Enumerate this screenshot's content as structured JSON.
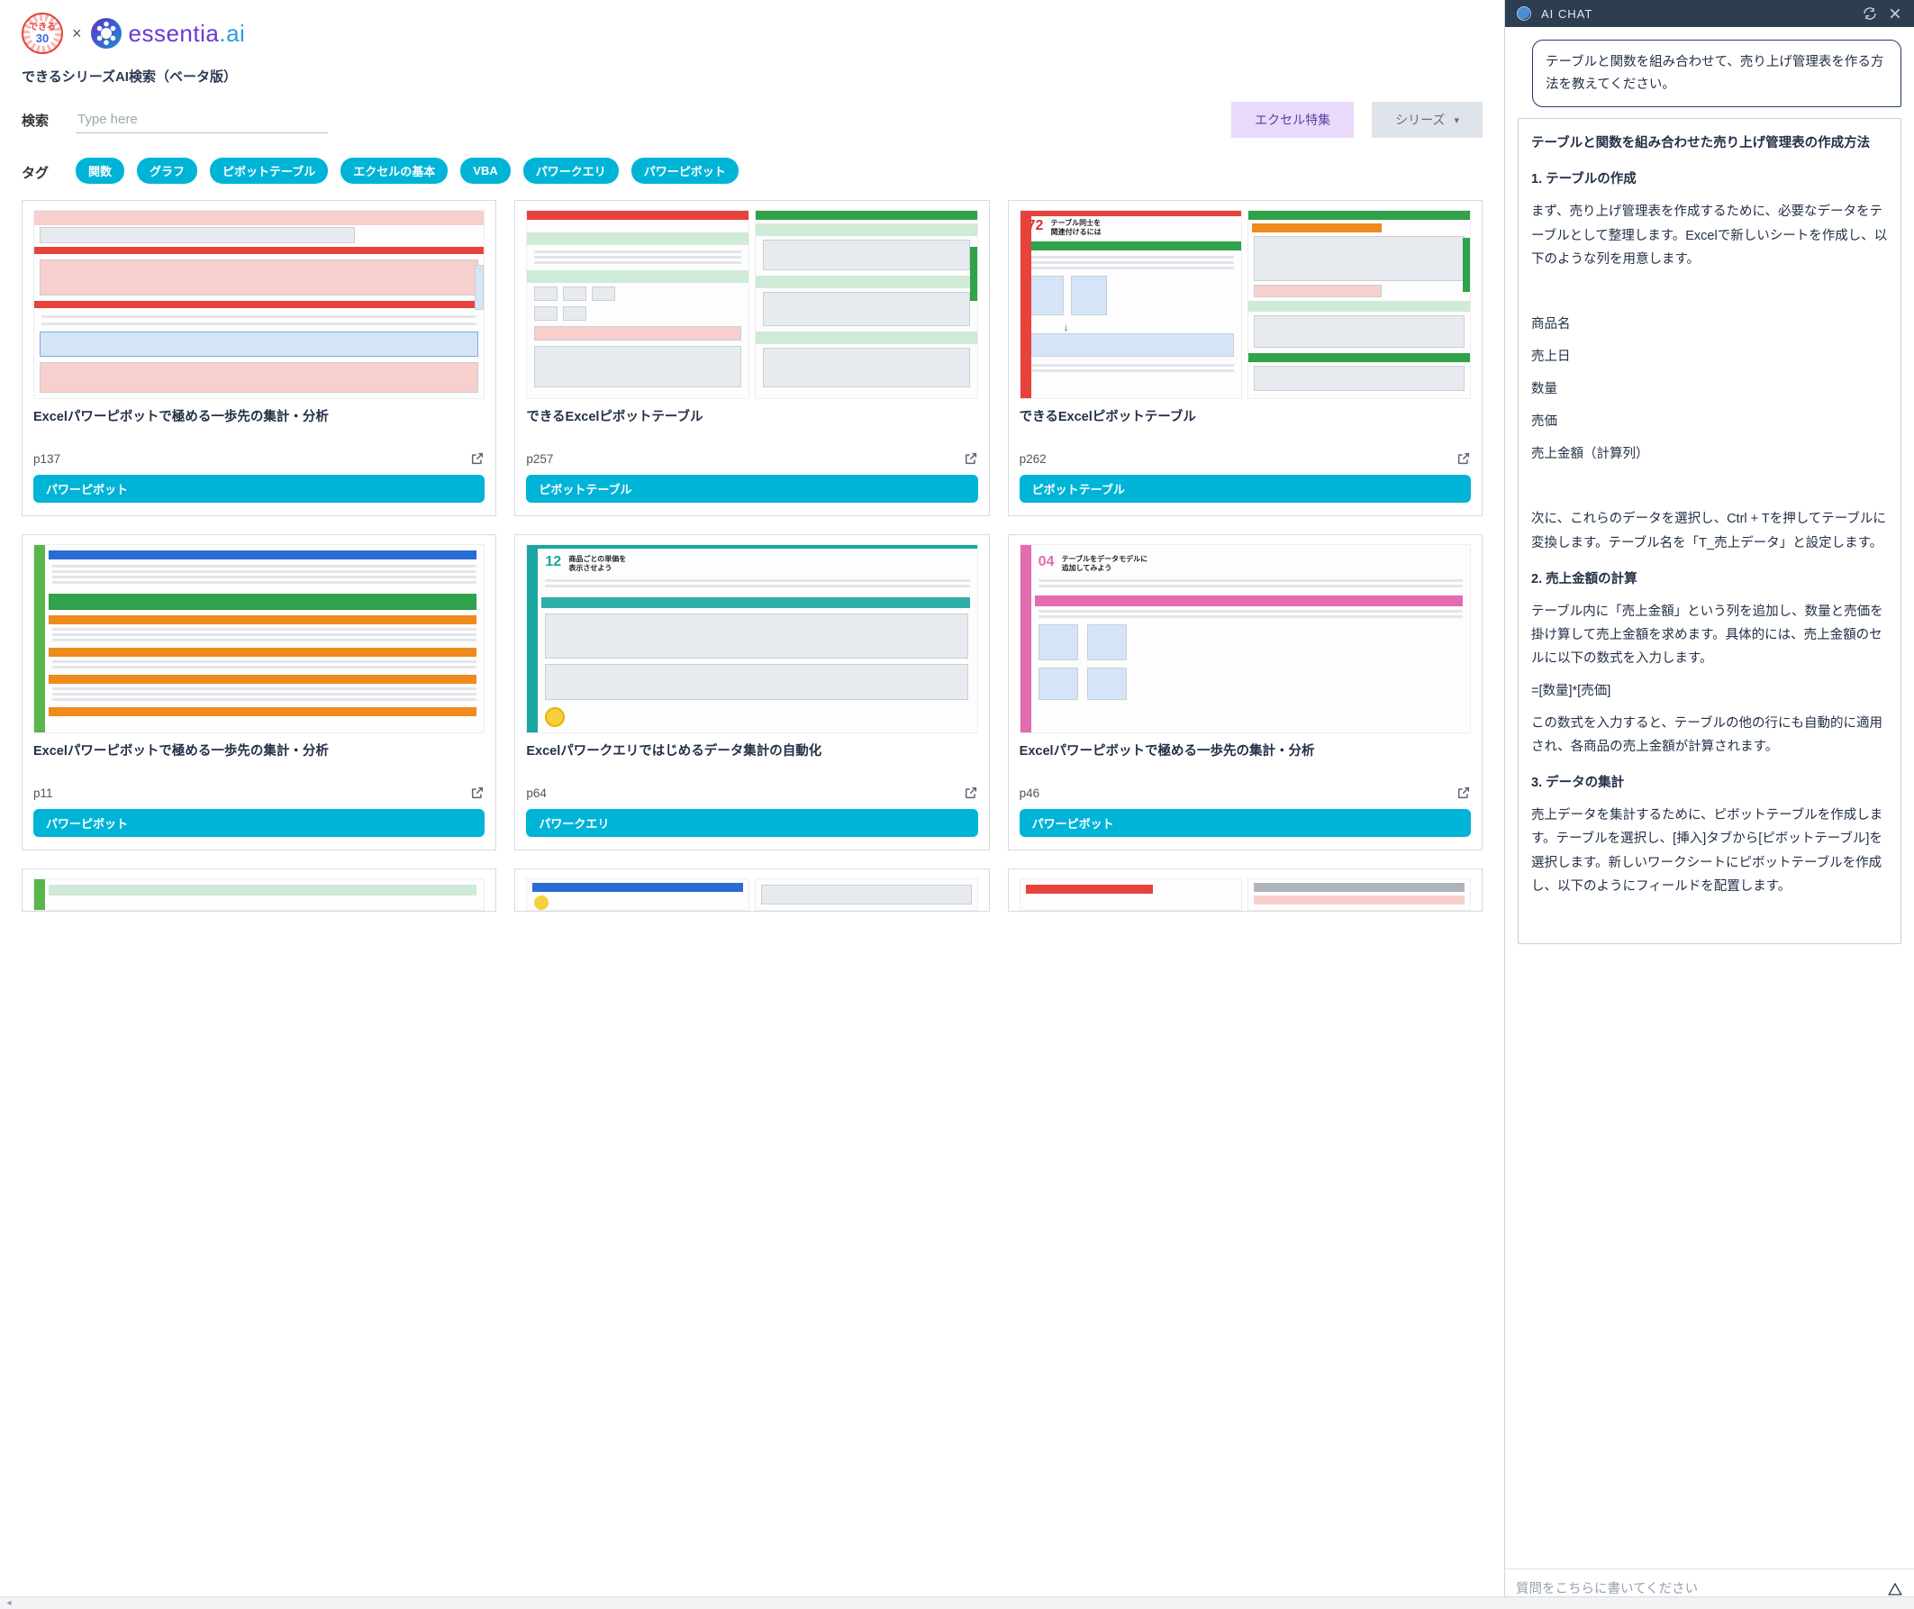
{
  "header": {
    "brand_x": "×",
    "brand_text_a": "essentia",
    "brand_text_b": ".ai",
    "badge_top": "できる",
    "badge_num": "30",
    "site_title": "できるシリーズAI検索（ベータ版）"
  },
  "search": {
    "label": "検索",
    "placeholder": "Type here",
    "btn_topic": "エクセル特集",
    "btn_series": "シリーズ"
  },
  "tags": {
    "label": "タグ",
    "items": [
      "関数",
      "グラフ",
      "ピボットテーブル",
      "エクセルの基本",
      "VBA",
      "パワークエリ",
      "パワーピボット"
    ]
  },
  "results": [
    {
      "title": "Excelパワーピボットで極める一歩先の集計・分析",
      "page": "p137",
      "tag": "パワーピボット"
    },
    {
      "title": "できるExcelピボットテーブル",
      "page": "p257",
      "tag": "ピボットテーブル"
    },
    {
      "title": "できるExcelピボットテーブル",
      "page": "p262",
      "tag": "ピボットテーブル"
    },
    {
      "title": "Excelパワーピボットで極める一歩先の集計・分析",
      "page": "p11",
      "tag": "パワーピボット"
    },
    {
      "title": "Excelパワークエリではじめるデータ集計の自動化",
      "page": "p64",
      "tag": "パワークエリ"
    },
    {
      "title": "Excelパワーピボットで極める一歩先の集計・分析",
      "page": "p46",
      "tag": "パワーピボット"
    }
  ],
  "thumb_labels": {
    "r0c2_num": "72",
    "r0c2_title_a": "テーブル同士を",
    "r0c2_title_b": "関連付けるには",
    "r1c1_num": "12",
    "r1c1_title_a": "商品ごとの単価を",
    "r1c1_title_b": "表示させよう",
    "r1c2_num": "04",
    "r1c2_title_a": "テーブルをデータモデルに",
    "r1c2_title_b": "追加してみよう"
  },
  "chat": {
    "title": "AI CHAT",
    "user_msg": "テーブルと関数を組み合わせて、売り上げ管理表を作る方法を教えてください。",
    "input_placeholder": "質問をこちらに書いてください",
    "ai": {
      "h0": "テーブルと関数を組み合わせた売り上げ管理表の作成方法",
      "h1": "1. テーブルの作成",
      "p1": "まず、売り上げ管理表を作成するために、必要なデータをテーブルとして整理します。Excelで新しいシートを作成し、以下のような列を用意します。",
      "cols": [
        "商品名",
        "売上日",
        "数量",
        "売価",
        "売上金額（計算列）"
      ],
      "p2": "次に、これらのデータを選択し、Ctrl + Tを押してテーブルに変換します。テーブル名を「T_売上データ」と設定します。",
      "h2": "2. 売上金額の計算",
      "p3": "テーブル内に「売上金額」という列を追加し、数量と売価を掛け算して売上金額を求めます。具体的には、売上金額のセルに以下の数式を入力します。",
      "formula": "=[数量]*[売価]",
      "p4": "この数式を入力すると、テーブルの他の行にも自動的に適用され、各商品の売上金額が計算されます。",
      "h3": "3. データの集計",
      "p5": "売上データを集計するために、ピボットテーブルを作成します。テーブルを選択し、[挿入]タブから[ピボットテーブル]を選択します。新しいワークシートにピボットテーブルを作成し、以下のようにフィールドを配置します。"
    }
  }
}
